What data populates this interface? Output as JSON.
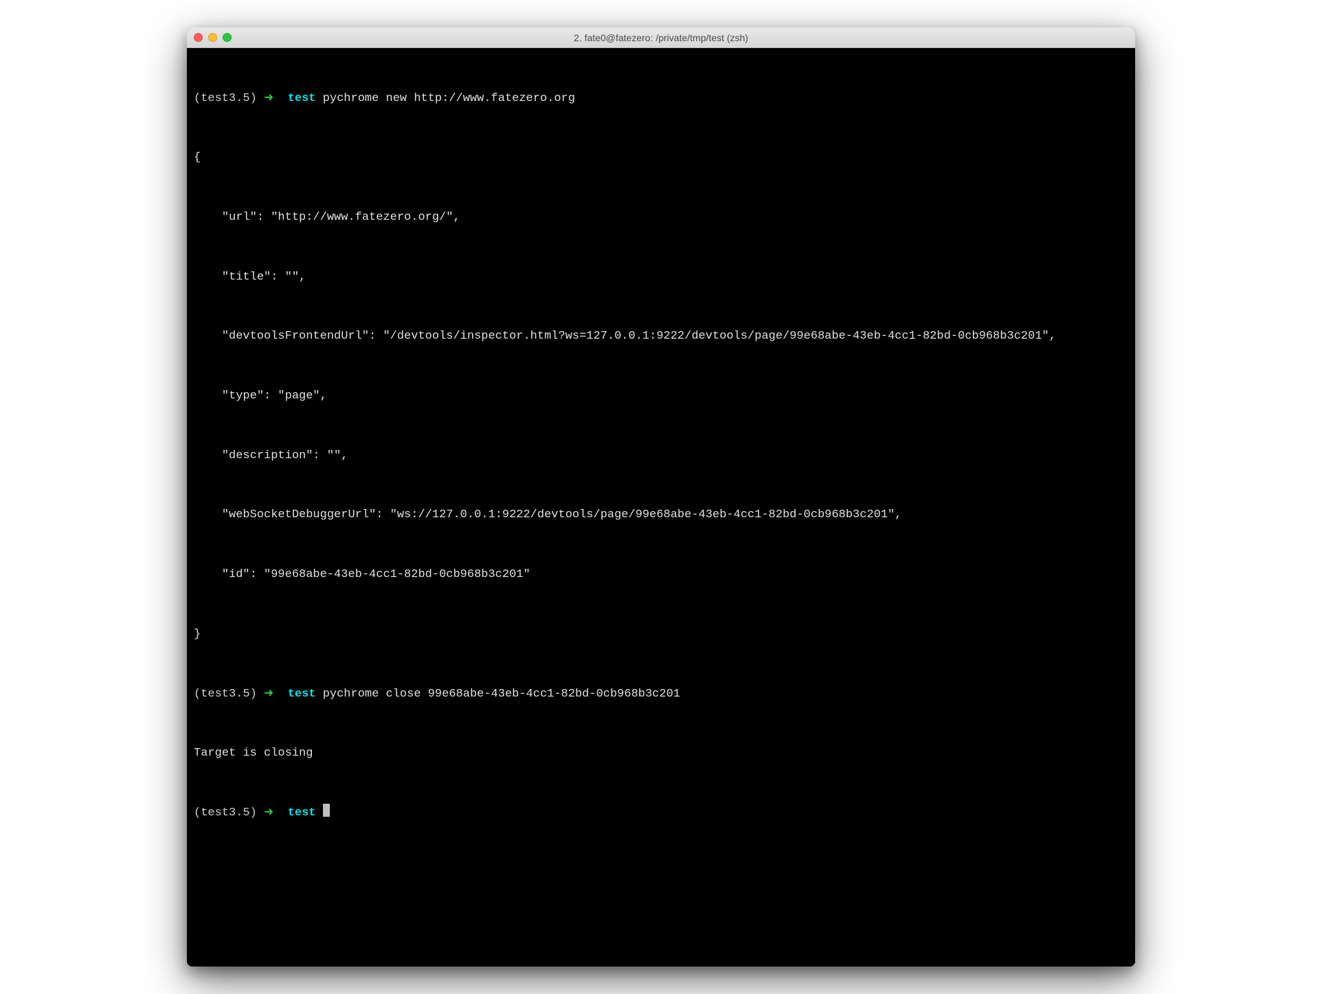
{
  "window": {
    "title": "2. fate0@fatezero: /private/tmp/test (zsh)"
  },
  "prompts": [
    {
      "venv": "(test3.5)",
      "arrow": "➜",
      "dir": "test",
      "cmd": "pychrome new http://www.fatezero.org"
    },
    {
      "venv": "(test3.5)",
      "arrow": "➜",
      "dir": "test",
      "cmd": "pychrome close 99e68abe-43eb-4cc1-82bd-0cb968b3c201"
    },
    {
      "venv": "(test3.5)",
      "arrow": "➜",
      "dir": "test",
      "cmd": ""
    }
  ],
  "output1": {
    "l0": "{",
    "l1": "    \"url\": \"http://www.fatezero.org/\",",
    "l2": "    \"title\": \"\",",
    "l3": "    \"devtoolsFrontendUrl\": \"/devtools/inspector.html?ws=127.0.0.1:9222/devtools/page/99e68abe-43eb-4cc1-82bd-0cb968b3c201\",",
    "l4": "    \"type\": \"page\",",
    "l5": "    \"description\": \"\",",
    "l6": "    \"webSocketDebuggerUrl\": \"ws://127.0.0.1:9222/devtools/page/99e68abe-43eb-4cc1-82bd-0cb968b3c201\",",
    "l7": "    \"id\": \"99e68abe-43eb-4cc1-82bd-0cb968b3c201\"",
    "l8": "}"
  },
  "output2": {
    "l0": "Target is closing"
  }
}
